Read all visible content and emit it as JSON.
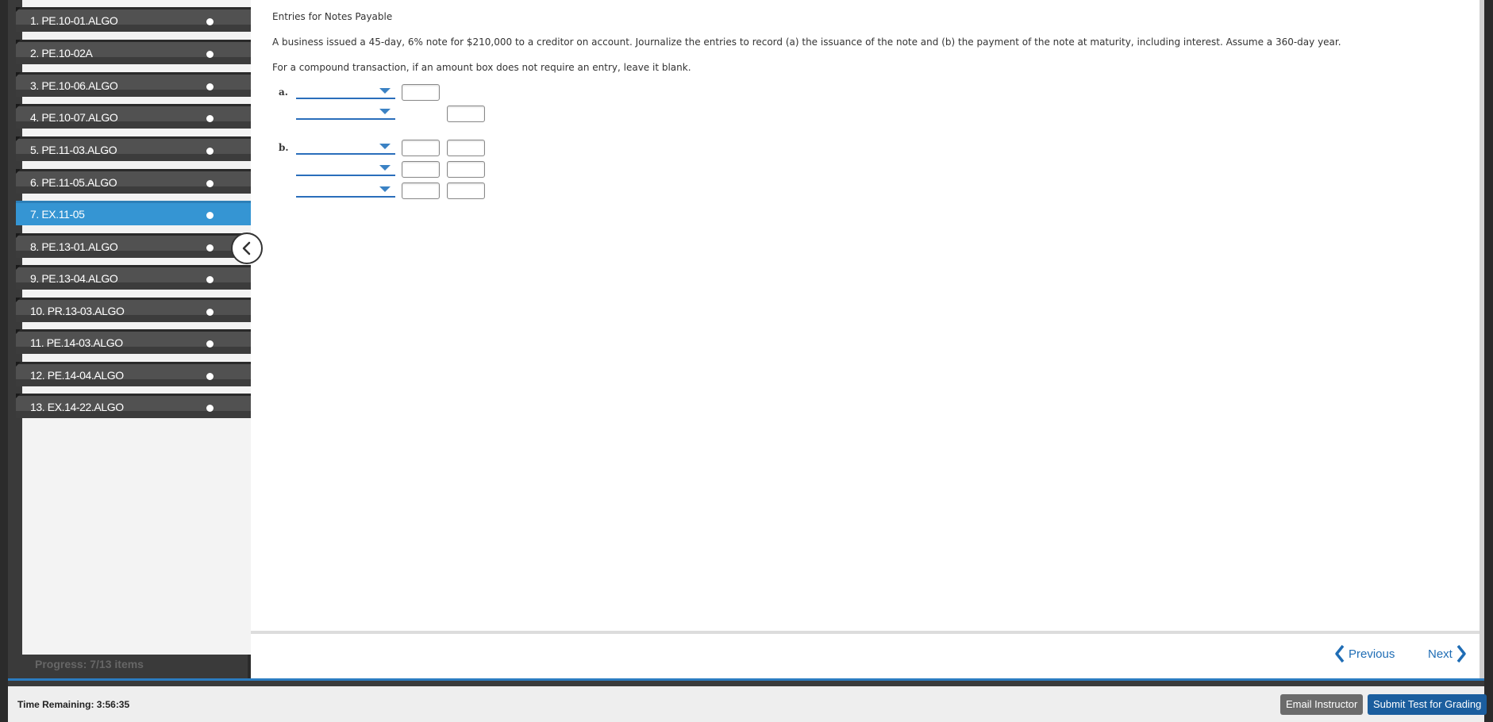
{
  "sidebar": {
    "items": [
      {
        "label": "1. PE.10-01.ALGO"
      },
      {
        "label": "2. PE.10-02A"
      },
      {
        "label": "3. PE.10-06.ALGO"
      },
      {
        "label": "4. PE.10-07.ALGO"
      },
      {
        "label": "5. PE.11-03.ALGO"
      },
      {
        "label": "6. PE.11-05.ALGO"
      },
      {
        "label": "7. EX.11-05"
      },
      {
        "label": "8. PE.13-01.ALGO"
      },
      {
        "label": "9. PE.13-04.ALGO"
      },
      {
        "label": "10. PR.13-03.ALGO"
      },
      {
        "label": "11. PE.14-03.ALGO"
      },
      {
        "label": "12. PE.14-04.ALGO"
      },
      {
        "label": "13. EX.14-22.ALGO"
      }
    ],
    "active_index": 6,
    "progress": "Progress:  7/13 items"
  },
  "question": {
    "title": "Entries for Notes Payable",
    "body": "A business issued a 45-day, 6% note for $210,000 to a creditor on account. Journalize the entries to record (a) the issuance of the note and (b) the payment of the note at maturity, including interest. Assume a 360-day year.",
    "instruction": "For a compound transaction, if an amount box does not require an entry, leave it blank.",
    "part_a_label": "a.",
    "part_b_label": "b."
  },
  "navigation": {
    "previous": "Previous",
    "next": "Next"
  },
  "footer": {
    "time_remaining": "Time Remaining: 3:56:35",
    "email_instructor": "Email Instructor",
    "submit": "Submit Test for Grading"
  },
  "colors": {
    "active_item": "#3595d3",
    "link_blue": "#1f6db5",
    "submit_blue": "#1b5e9e"
  }
}
